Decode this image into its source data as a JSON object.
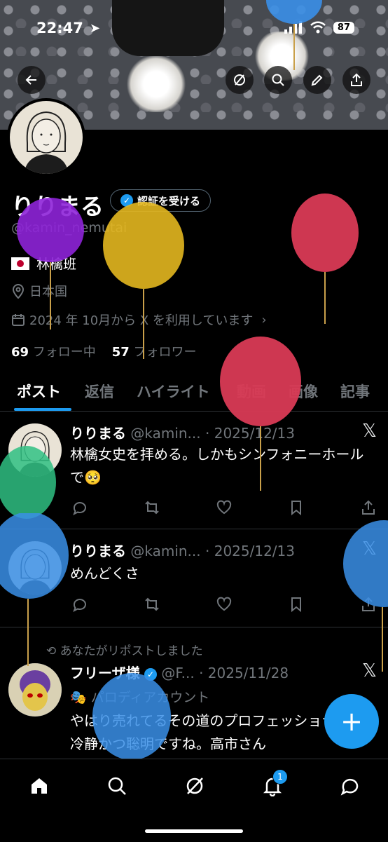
{
  "status_bar": {
    "time": "22:47",
    "battery": "87"
  },
  "profile": {
    "name": "りりまる",
    "verify_button": "認証を受ける",
    "handle": "@kamin_nemutai",
    "bio": "林檎班",
    "location": "日本国",
    "joined": "2024 年 10月から X を利用しています",
    "following_count": "69",
    "following_label": "フォロー中",
    "followers_count": "57",
    "followers_label": "フォロワー"
  },
  "tabs": [
    "ポスト",
    "返信",
    "ハイライト",
    "動画",
    "画像",
    "記事"
  ],
  "posts": [
    {
      "name": "りりまる",
      "handle": "@kamin...",
      "date": "· 2025/12/13",
      "text": "林檎女史を拝める。しかもシンフォニーホールで🥺"
    },
    {
      "name": "りりまる",
      "handle": "@kamin...",
      "date": "· 2025/12/13",
      "text": "めんどくさ"
    },
    {
      "repost_note": "あなたがリポストしました",
      "name": "フリーザ様",
      "handle": "@F...",
      "date": "· 2025/11/28",
      "label": "パロディアカウント",
      "text": "やはり売れてるその道のプロフェッショナルは冷静かつ聡明ですね。高市さん"
    }
  ],
  "notifications_badge": "1",
  "colors": {
    "accent": "#1d9bf0",
    "background": "#000000",
    "muted": "#71767b"
  }
}
